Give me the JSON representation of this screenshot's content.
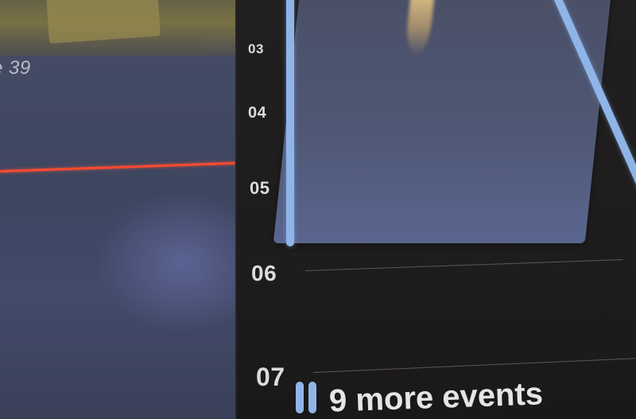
{
  "left_pane": {
    "caption": "e 39"
  },
  "timeline": {
    "hours": [
      {
        "label": "03"
      },
      {
        "label": "04"
      },
      {
        "label": "05"
      },
      {
        "label": "06"
      },
      {
        "label": "07"
      }
    ],
    "more_events": {
      "label": "9 more events"
    }
  },
  "colors": {
    "event_accent": "#8fb5e8",
    "now_indicator": "#ff4a2f",
    "background": "#1e1c1d"
  }
}
